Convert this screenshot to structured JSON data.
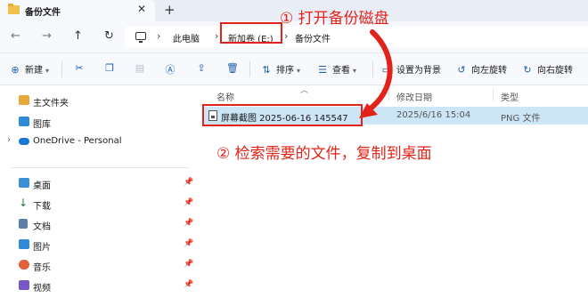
{
  "window": {
    "tab_title": "备份文件",
    "tab_close": "✕",
    "new_tab": "+"
  },
  "nav": {
    "back": "←",
    "forward": "→",
    "up": "↑",
    "refresh": "↻",
    "breadcrumb": [
      "此电脑",
      "新加卷 (E:)",
      "备份文件"
    ],
    "separator": "›"
  },
  "toolbar": {
    "new_label": "新建",
    "sort_label": "排序",
    "view_label": "查看",
    "set_background_label": "设置为背景",
    "rotate_left_label": "向左旋转",
    "rotate_right_label": "向右旋转"
  },
  "sidebar": {
    "items": [
      {
        "label": "主文件夹",
        "icon": "home-icon",
        "pinned": false
      },
      {
        "label": "图库",
        "icon": "gallery-icon",
        "pinned": false
      },
      {
        "label": "OneDrive - Personal",
        "icon": "cloud-icon",
        "pinned": false
      },
      {
        "label": "桌面",
        "icon": "desktop-icon",
        "pinned": true
      },
      {
        "label": "下载",
        "icon": "download-icon",
        "pinned": true
      },
      {
        "label": "文档",
        "icon": "documents-icon",
        "pinned": true
      },
      {
        "label": "图片",
        "icon": "pictures-icon",
        "pinned": true
      },
      {
        "label": "音乐",
        "icon": "music-icon",
        "pinned": true
      },
      {
        "label": "视频",
        "icon": "videos-icon",
        "pinned": true
      }
    ]
  },
  "file_list": {
    "columns": [
      "名称",
      "修改日期",
      "类型"
    ],
    "rows": [
      {
        "name": "屏幕截图 2025-06-16 145547",
        "modified": "2025/6/16 15:04",
        "type": "PNG 文件"
      }
    ]
  },
  "annotations": {
    "step1": "① 打开备份磁盘",
    "step2": "② 检索需要的文件，复制到桌面"
  },
  "colors": {
    "accent_red": "#e2231a",
    "selection": "#cde6f7",
    "chrome_bg": "#f7f9fc",
    "tab_strip": "#e9eef6"
  }
}
